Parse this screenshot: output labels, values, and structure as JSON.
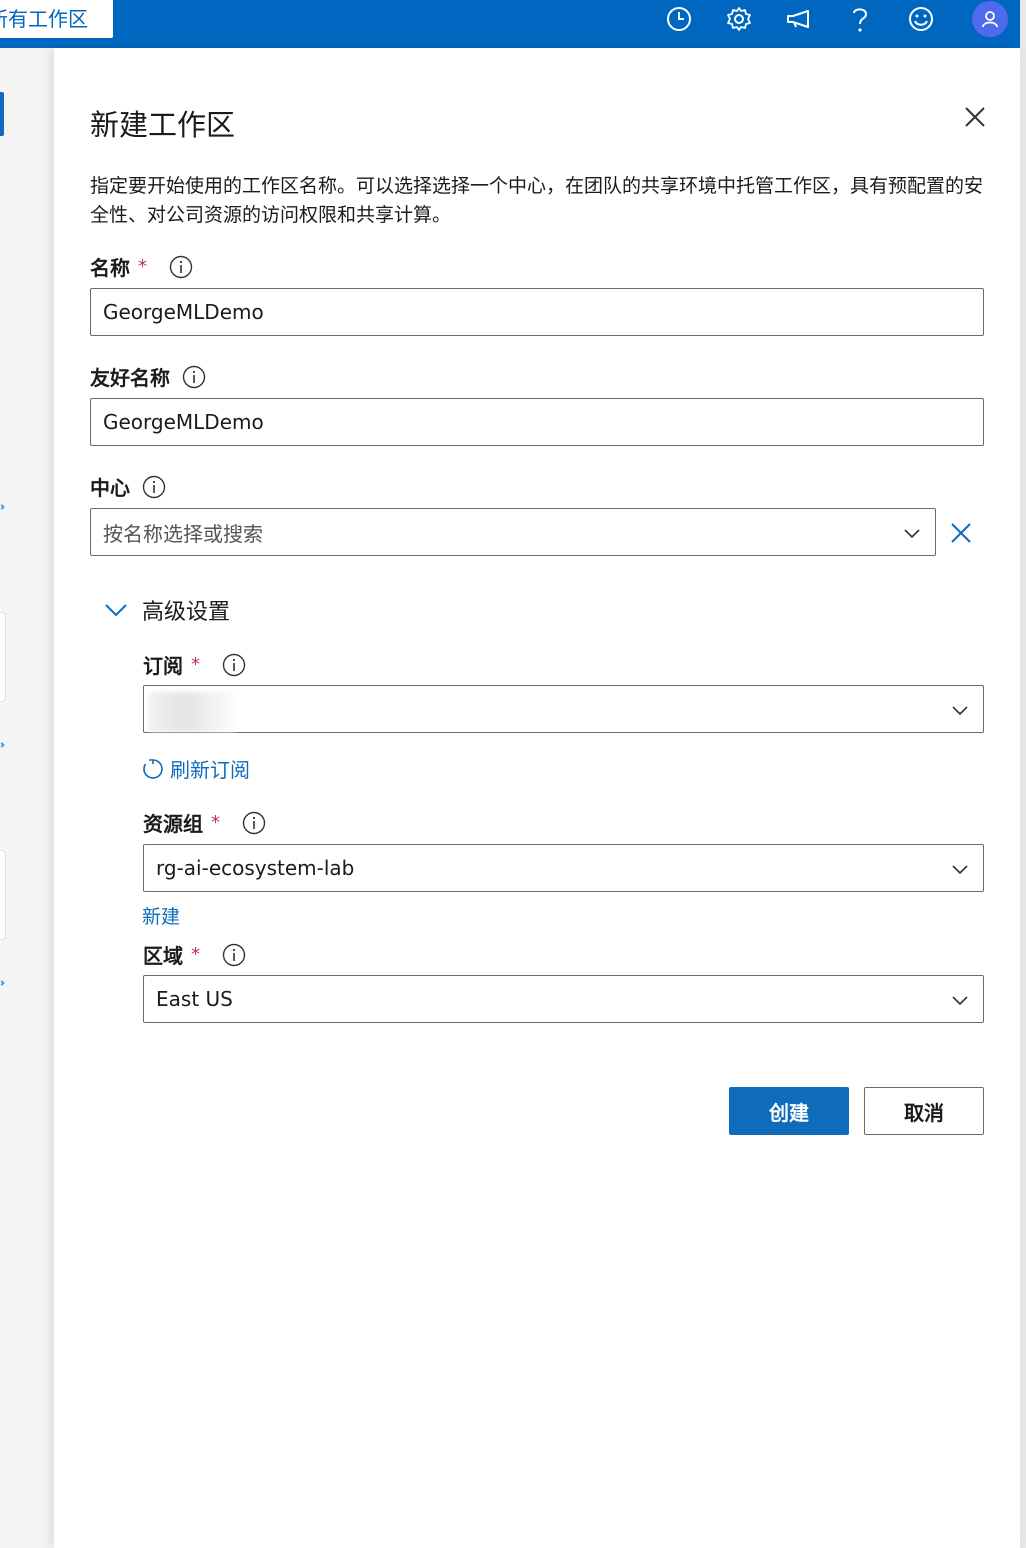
{
  "topbar": {
    "tab_label": "所有工作区",
    "icons": [
      "clock-icon",
      "gear-icon",
      "megaphone-icon",
      "help-icon",
      "smiley-icon",
      "avatar-icon"
    ],
    "brand_color": "#0067c0"
  },
  "panel": {
    "title": "新建工作区",
    "description": "指定要开始使用的工作区名称。可以选择选择一个中心，在团队的共享环境中托管工作区，具有预配置的安全性、对公司资源的访问权限和共享计算。",
    "name": {
      "label": "名称",
      "required_mark": "*",
      "value": "GeorgeMLDemo"
    },
    "friendly_name": {
      "label": "友好名称",
      "value": "GeorgeMLDemo"
    },
    "hub": {
      "label": "中心",
      "placeholder": "按名称选择或搜索"
    },
    "advanced": {
      "label": "高级设置",
      "subscription": {
        "label": "订阅",
        "required_mark": "*",
        "value": ""
      },
      "refresh_link": "刷新订阅",
      "resource_group": {
        "label": "资源组",
        "required_mark": "*",
        "value": "rg-ai-ecosystem-lab"
      },
      "new_link": "新建",
      "region": {
        "label": "区域",
        "required_mark": "*",
        "value": "East US"
      }
    },
    "buttons": {
      "create": "创建",
      "cancel": "取消"
    },
    "accent_color": "#0f6cbd",
    "required_color": "#c4314b"
  }
}
